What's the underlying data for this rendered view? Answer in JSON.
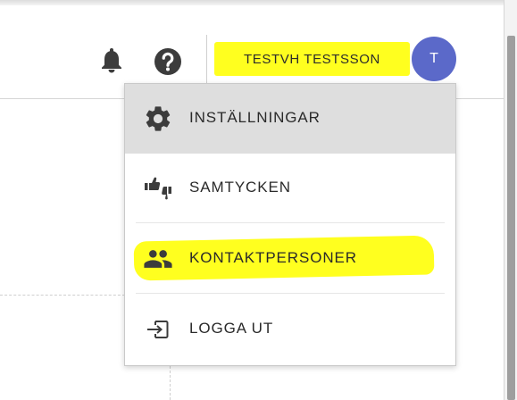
{
  "header": {
    "user_name": "TESTVH TESTSSON",
    "avatar_initial": "T"
  },
  "menu": {
    "items": [
      {
        "label": "INSTÄLLNINGAR",
        "icon": "gear-icon",
        "active": true
      },
      {
        "label": "SAMTYCKEN",
        "icon": "thumbs-up-down-icon",
        "active": false
      },
      {
        "label": "KONTAKTPERSONER",
        "icon": "people-icon",
        "active": false,
        "highlighted": true
      },
      {
        "label": "LOGGA UT",
        "icon": "logout-icon",
        "active": false
      }
    ]
  },
  "colors": {
    "highlight": "#ffff1f",
    "avatar_bg": "#5b69c9",
    "active_item_bg": "#dedede",
    "icon": "#3c3c3c"
  }
}
